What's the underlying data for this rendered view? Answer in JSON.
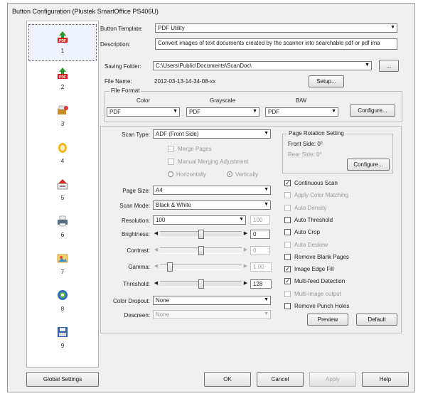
{
  "window": {
    "title": "Button Configuration (Plustek SmartOffice PS406U)"
  },
  "buttons": [
    {
      "num": "1",
      "icon": "pdf-icon"
    },
    {
      "num": "2",
      "icon": "pdf-icon"
    },
    {
      "num": "3",
      "icon": "scanner-icon"
    },
    {
      "num": "4",
      "icon": "folder-icon"
    },
    {
      "num": "5",
      "icon": "email-icon"
    },
    {
      "num": "6",
      "icon": "printer-icon"
    },
    {
      "num": "7",
      "icon": "image-icon"
    },
    {
      "num": "8",
      "icon": "ocr-icon"
    },
    {
      "num": "9",
      "icon": "save-icon"
    }
  ],
  "template": {
    "label": "Button Template:",
    "value": "PDF Utility",
    "desc_label": "Description:",
    "desc_value": "Convert images of text documents created by the scanner into searchable pdf or pdf ima"
  },
  "saving": {
    "folder_label": "Saving Folder:",
    "folder_value": "C:\\Users\\Public\\Documents\\ScanDoc\\",
    "browse_label": "...",
    "filename_label": "File Name:",
    "filename_value": "2012-03-13-14-34-08-xx",
    "setup_label": "Setup...",
    "format_group": "File Format",
    "color_label": "Color",
    "grayscale_label": "Grayscale",
    "bw_label": "B/W",
    "color_value": "PDF",
    "grayscale_value": "PDF",
    "bw_value": "PDF",
    "configure_label": "Configure..."
  },
  "scan": {
    "type_label": "Scan Type:",
    "type_value": "ADF (Front Side)",
    "merge_pages": "Merge Pages",
    "manual_merge": "Manual Merging Adjustment",
    "horizontally": "Horizontally",
    "vertically": "Vertically",
    "page_size_label": "Page Size:",
    "page_size_value": "A4",
    "scan_mode_label": "Scan Mode:",
    "scan_mode_value": "Black & White",
    "resolution_label": "Resolution:",
    "resolution_value": "100",
    "resolution_side": "100",
    "brightness_label": "Brightness:",
    "brightness_value": "0",
    "brightness_level": 0.5,
    "contrast_label": "Contrast:",
    "contrast_value": "0",
    "contrast_level": 0.5,
    "gamma_label": "Gamma:",
    "gamma_value": "1.00",
    "gamma_level": 0.12,
    "threshold_label": "Threshold:",
    "threshold_value": "128",
    "threshold_level": 0.5,
    "color_dropout_label": "Color Dropout:",
    "color_dropout_value": "None",
    "descreen_label": "Descreen:",
    "descreen_value": "None"
  },
  "rotation": {
    "group": "Page Rotation Setting",
    "front": "Front Side: 0°",
    "rear": "Rear Side: 0°",
    "configure_label": "Configure..."
  },
  "options": [
    {
      "label": "Continuous Scan",
      "checked": true,
      "enabled": true
    },
    {
      "label": "Apply Color Matching",
      "checked": false,
      "enabled": false
    },
    {
      "label": "Auto Density",
      "checked": false,
      "enabled": false
    },
    {
      "label": "Auto Threshold",
      "checked": false,
      "enabled": true
    },
    {
      "label": "Auto Crop",
      "checked": false,
      "enabled": true
    },
    {
      "label": "Auto Deskew",
      "checked": false,
      "enabled": false
    },
    {
      "label": "Remove Blank Pages",
      "checked": false,
      "enabled": true
    },
    {
      "label": "Image Edge Fill",
      "checked": true,
      "enabled": true
    },
    {
      "label": "Multi-feed Detection",
      "checked": true,
      "enabled": true
    },
    {
      "label": "Multi-image output",
      "checked": false,
      "enabled": false
    },
    {
      "label": "Remove Punch Holes",
      "checked": false,
      "enabled": true
    }
  ],
  "actions": {
    "preview": "Preview",
    "default": "Default",
    "global_settings": "Global Settings",
    "ok": "OK",
    "cancel": "Cancel",
    "apply": "Apply",
    "help": "Help"
  }
}
